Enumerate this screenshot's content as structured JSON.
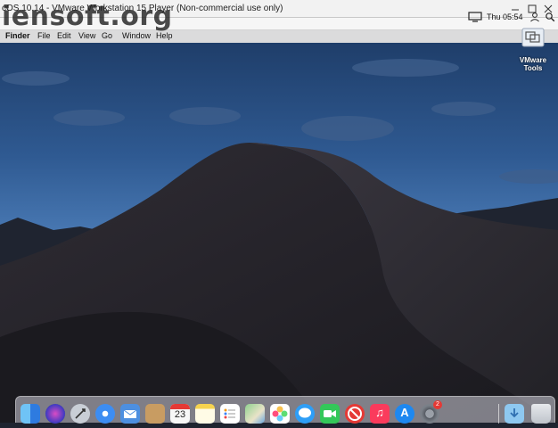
{
  "window": {
    "title": "cOS 10.14 - VMware Workstation 15 Player (Non-commercial use only)",
    "watermark": "iensoft.org"
  },
  "tray": {
    "time": "Thu 05:54"
  },
  "menubar": {
    "items": [
      "Finder",
      "File",
      "Edit",
      "View",
      "Go",
      "Window",
      "Help"
    ]
  },
  "desktop": {
    "icon_label": "VMware Tools"
  },
  "dock": {
    "calendar_day": "23",
    "badge_count": "2",
    "items": [
      "finder-icon",
      "siri-icon",
      "launchpad-icon",
      "safari-icon",
      "mail-icon",
      "contacts-icon",
      "calendar-icon",
      "notes-icon",
      "reminders-icon",
      "maps-icon",
      "photos-icon",
      "messages-icon",
      "facetime-icon",
      "news-icon",
      "music-icon",
      "app-store-icon",
      "system-preferences-icon",
      "downloads-folder-icon",
      "trash-icon"
    ]
  },
  "colors": {
    "sky_top": "#2a4d7d",
    "sky_horizon": "#5e8fc4",
    "dune_dark": "#1c1b20",
    "dune_mid": "#2b2930"
  }
}
